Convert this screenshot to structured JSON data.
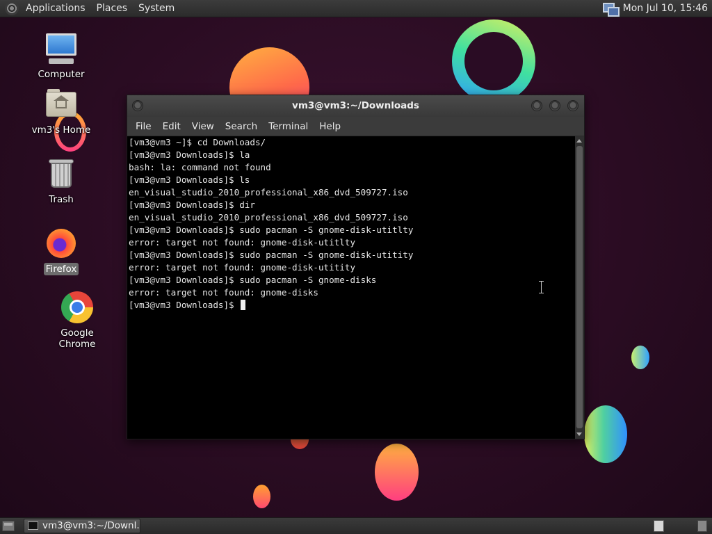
{
  "top_panel": {
    "menus": [
      "Applications",
      "Places",
      "System"
    ],
    "clock": "Mon Jul 10, 15:46",
    "network_icon": "network-status-icon"
  },
  "desktop_icons": [
    {
      "label": "Computer",
      "icon": "computer-icon"
    },
    {
      "label": "vm3's Home",
      "icon": "home-folder-icon"
    },
    {
      "label": "Trash",
      "icon": "trash-icon"
    },
    {
      "label": "Firefox",
      "icon": "firefox-icon",
      "selected": true
    },
    {
      "label": "Google Chrome",
      "icon": "chrome-icon"
    }
  ],
  "terminal": {
    "title": "vm3@vm3:~/Downloads",
    "menus": [
      "File",
      "Edit",
      "View",
      "Search",
      "Terminal",
      "Help"
    ],
    "lines": [
      "[vm3@vm3 ~]$ cd Downloads/",
      "[vm3@vm3 Downloads]$ la",
      "bash: la: command not found",
      "[vm3@vm3 Downloads]$ ls",
      "en_visual_studio_2010_professional_x86_dvd_509727.iso",
      "[vm3@vm3 Downloads]$ dir",
      "en_visual_studio_2010_professional_x86_dvd_509727.iso",
      "[vm3@vm3 Downloads]$ sudo pacman -S gnome-disk-utitlty",
      "error: target not found: gnome-disk-utitlty",
      "[vm3@vm3 Downloads]$ sudo pacman -S gnome-disk-utitity",
      "error: target not found: gnome-disk-utitity",
      "[vm3@vm3 Downloads]$ sudo pacman -S gnome-disks",
      "error: target not found: gnome-disks"
    ],
    "prompt": "[vm3@vm3 Downloads]$ "
  },
  "bottom_panel": {
    "task_label": "vm3@vm3:~/Downl..."
  }
}
